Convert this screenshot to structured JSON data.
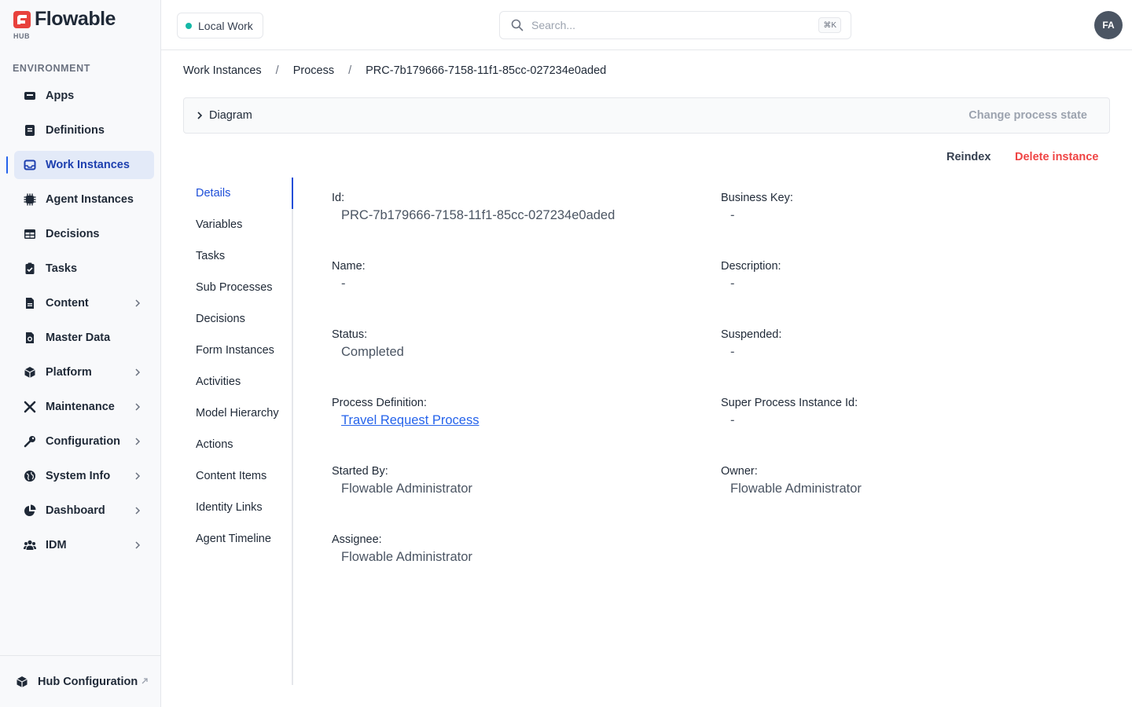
{
  "brand": {
    "name": "Flowable",
    "sub": "HUB"
  },
  "sidebar": {
    "section_label": "ENVIRONMENT",
    "items": [
      {
        "label": "Apps",
        "icon": "apps-icon",
        "chevron": false
      },
      {
        "label": "Definitions",
        "icon": "definitions-icon",
        "chevron": false
      },
      {
        "label": "Work Instances",
        "icon": "inbox-icon",
        "chevron": false,
        "active": true
      },
      {
        "label": "Agent Instances",
        "icon": "chip-icon",
        "chevron": false
      },
      {
        "label": "Decisions",
        "icon": "table-icon",
        "chevron": false
      },
      {
        "label": "Tasks",
        "icon": "clipboard-icon",
        "chevron": false
      },
      {
        "label": "Content",
        "icon": "document-icon",
        "chevron": true
      },
      {
        "label": "Master Data",
        "icon": "data-icon",
        "chevron": false
      },
      {
        "label": "Platform",
        "icon": "cube-icon",
        "chevron": true
      },
      {
        "label": "Maintenance",
        "icon": "tools-icon",
        "chevron": true
      },
      {
        "label": "Configuration",
        "icon": "key-icon",
        "chevron": true
      },
      {
        "label": "System Info",
        "icon": "globe-icon",
        "chevron": true
      },
      {
        "label": "Dashboard",
        "icon": "pie-chart-icon",
        "chevron": true
      },
      {
        "label": "IDM",
        "icon": "users-icon",
        "chevron": true
      }
    ],
    "footer_label": "Hub Configuration"
  },
  "header": {
    "environment": "Local Work",
    "search_placeholder": "Search...",
    "shortcut": "⌘K",
    "avatar_initials": "FA"
  },
  "breadcrumb": [
    "Work Instances",
    "Process",
    "PRC-7b179666-7158-11f1-85cc-027234e0aded"
  ],
  "diagram": {
    "label": "Diagram",
    "change_state": "Change process state"
  },
  "actions": {
    "reindex": "Reindex",
    "delete": "Delete instance"
  },
  "subnav": [
    "Details",
    "Variables",
    "Tasks",
    "Sub Processes",
    "Decisions",
    "Form Instances",
    "Activities",
    "Model Hierarchy",
    "Actions",
    "Content Items",
    "Identity Links",
    "Agent Timeline"
  ],
  "details": {
    "id": {
      "label": "Id:",
      "value": "PRC-7b179666-7158-11f1-85cc-027234e0aded"
    },
    "business_key": {
      "label": "Business Key:",
      "value": "-"
    },
    "name": {
      "label": "Name:",
      "value": "-"
    },
    "description": {
      "label": "Description:",
      "value": "-"
    },
    "status": {
      "label": "Status:",
      "value": "Completed"
    },
    "suspended": {
      "label": "Suspended:",
      "value": "-"
    },
    "process_definition": {
      "label": "Process Definition:",
      "value": "Travel Request Process"
    },
    "super_process": {
      "label": "Super Process Instance Id:",
      "value": "-"
    },
    "started_by": {
      "label": "Started By:",
      "value": "Flowable Administrator"
    },
    "owner": {
      "label": "Owner:",
      "value": "Flowable Administrator"
    },
    "assignee": {
      "label": "Assignee:",
      "value": "Flowable Administrator"
    }
  }
}
